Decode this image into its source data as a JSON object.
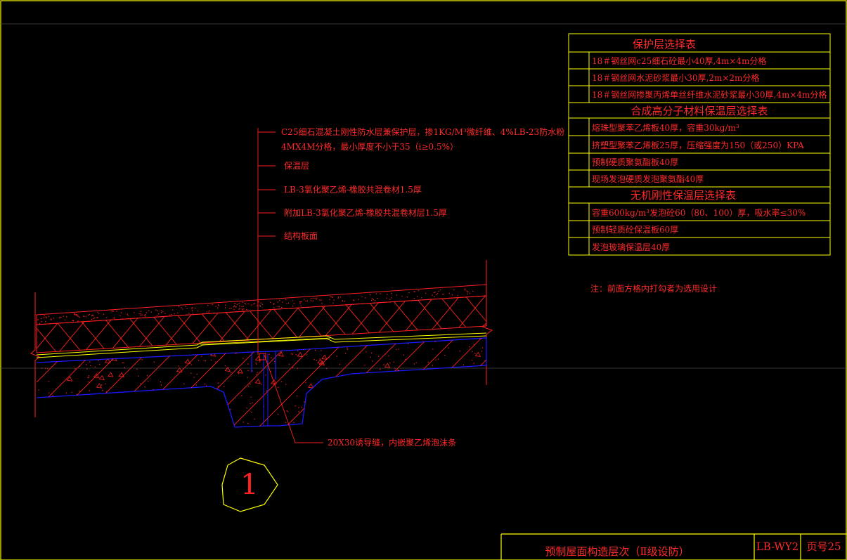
{
  "drawing": {
    "callouts": [
      "C25细石混凝土刚性防水层兼保护层，掺1KG/M³微纤维、4%LB-23防水粉",
      "4MX4M分格，最小厚度不小于35（i≥0.5%）",
      "保温层",
      "LB-3氯化聚乙烯-橡胶共混卷材1.5厚",
      "附加LB-3氯化聚乙烯-橡胶共混卷材层1.5厚",
      "结构板面"
    ],
    "joint_note": "20X30诱导缝，内嵌聚乙烯泡沫条",
    "detail_number": "1",
    "note": "注：前面方格内打勾者为选用设计"
  },
  "tables": {
    "protection": {
      "title": "保护层选择表",
      "rows": [
        "18＃钢丝网c25细石砼最小40厚,4m×4m分格",
        "18＃钢丝网水泥砂浆最小30厚,2m×2m分格",
        "18＃钢丝网掺聚丙烯单丝纤维水泥砂浆最小30厚,4m×4m分格"
      ]
    },
    "polymer": {
      "title": "合成高分子材料保温层选择表",
      "rows": [
        "熔珠型聚苯乙烯板40厚，容重30kg/m³",
        "挤塑型聚苯乙烯板25厚，压缩强度为150（或250）KPA",
        "预制硬质聚氨酯板40厚",
        "现场发泡硬质发泡聚氨酯40厚"
      ]
    },
    "inorganic": {
      "title": "无机刚性保温层选择表",
      "rows": [
        "容重600kg/m³发泡砼60（80、100）厚，吸水率≤30%",
        "预制轻质砼保温板60厚",
        "发泡玻璃保温层40厚"
      ]
    }
  },
  "title_block": {
    "title": "预制屋面构造层次（Ⅱ级设防）",
    "code": "LB-WY2",
    "page": "页号25"
  },
  "colors": {
    "background": "#000000",
    "text": "#ff2a2a",
    "frame": "#ffff00",
    "slab": "#0000ff",
    "insulation": "#ff0000",
    "membrane": "#ffff00"
  }
}
